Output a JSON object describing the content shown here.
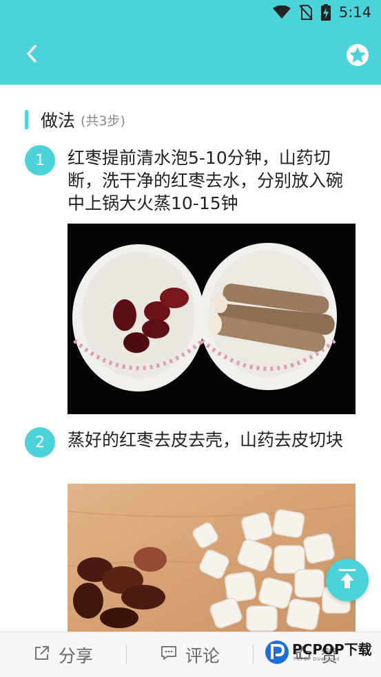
{
  "status_bar": {
    "time": "5:14",
    "icons": [
      "wifi-icon",
      "no-sim-icon",
      "battery-charging-icon"
    ]
  },
  "header": {
    "back_icon": "chevron-left-icon",
    "favorite_icon": "star-icon"
  },
  "section": {
    "title": "做法",
    "count": "(共3步)"
  },
  "steps": [
    {
      "number": "1",
      "text": "红枣提前清水泡5-10分钟，山药切断，洗干净的红枣去水，分别放入碗中上锅大火蒸10-15钟",
      "image": "two bowls with red dates and yam on black background"
    },
    {
      "number": "2",
      "text": "蒸好的红枣去皮去壳，山药去皮切块",
      "image": "peeled red dates and chopped yam on wooden board"
    }
  ],
  "floating": {
    "scroll_top_icon": "arrow-up-to-top-icon"
  },
  "bottom_bar": {
    "items": [
      {
        "label": "分享",
        "icon": "share-icon"
      },
      {
        "label": "评论",
        "icon": "comment-icon"
      },
      {
        "label": "赞",
        "icon": "like-icon"
      }
    ]
  },
  "watermark": {
    "brand": "PCPOP下载",
    "sub": "PCPOP Download"
  },
  "colors": {
    "accent": "#4cd3d9",
    "text": "#222222",
    "muted": "#888888"
  }
}
